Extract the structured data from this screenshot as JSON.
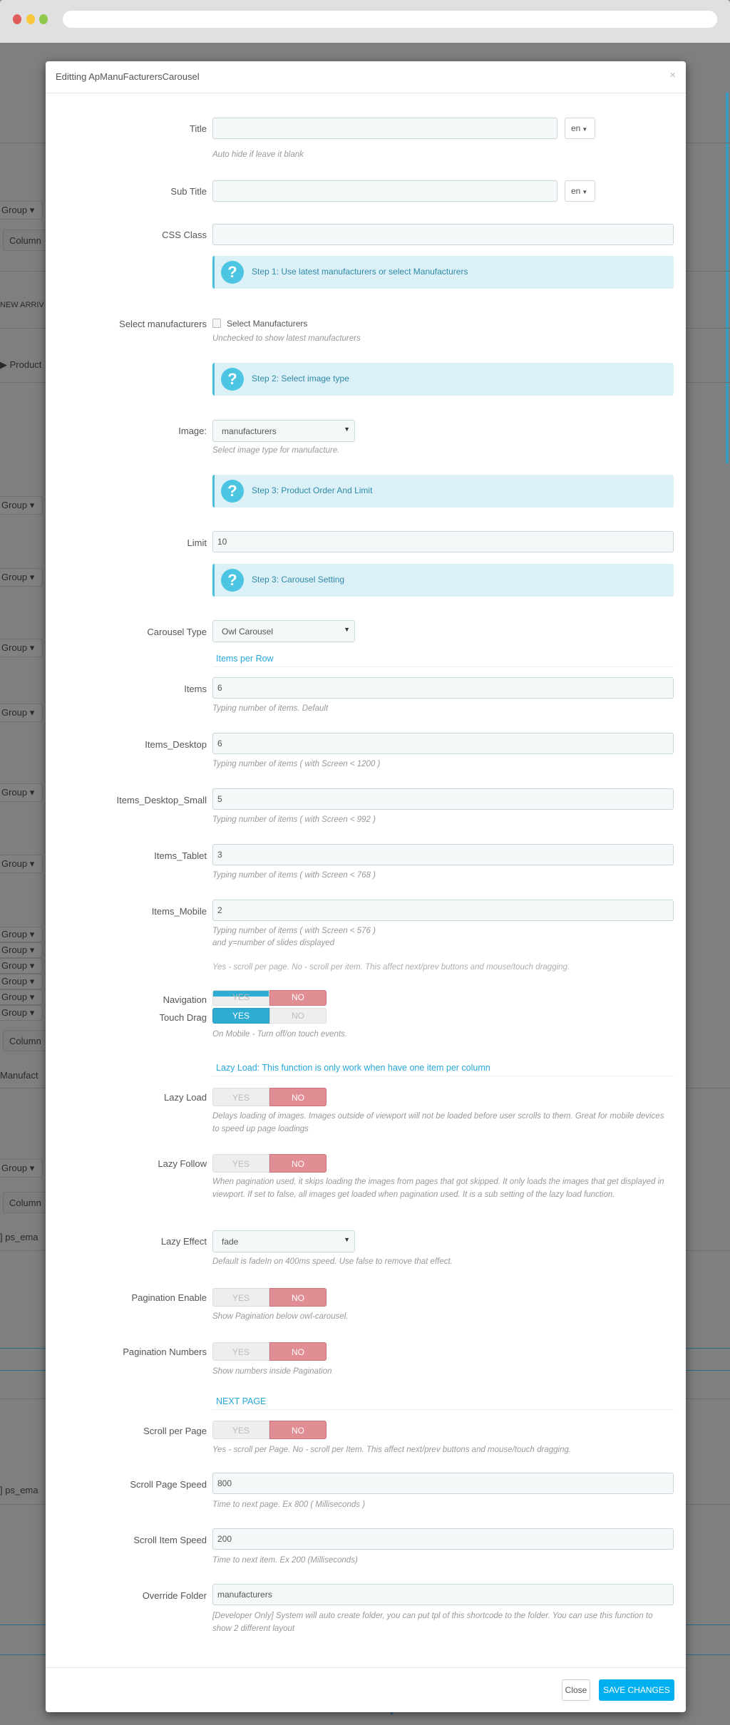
{
  "browser": {},
  "background": {
    "fragments": {
      "group": "Group ▾",
      "column": "Column",
      "new_arrivals": "NEW ARRIV",
      "product": "Product",
      "manufacturers": "Manufact",
      "ps_email": "ps_ema"
    }
  },
  "modal": {
    "title": "Editting ApManuFacturersCarousel",
    "close_icon": "×",
    "fields": {
      "title": {
        "label": "Title",
        "value": "",
        "lang": "en",
        "help": "Auto hide if leave it blank"
      },
      "sub_title": {
        "label": "Sub Title",
        "value": "",
        "lang": "en"
      },
      "css_class": {
        "label": "CSS Class",
        "value": ""
      },
      "select_manufacturers": {
        "label": "Select manufacturers",
        "checkbox_label": "Select Manufacturers",
        "checked": false,
        "help": "Unchecked to show latest manufacturers"
      },
      "image": {
        "label": "Image:",
        "value": "manufacturers",
        "help": "Select image type for manufacture."
      },
      "limit": {
        "label": "Limit",
        "value": "10"
      },
      "carousel_type": {
        "label": "Carousel Type",
        "value": "Owl Carousel"
      },
      "items": {
        "label": "Items",
        "value": "6",
        "help": "Typing number of items. Default"
      },
      "items_desktop": {
        "label": "Items_Desktop",
        "value": "6",
        "help": "Typing number of items ( with Screen < 1200 )"
      },
      "items_desktop_small": {
        "label": "Items_Desktop_Small",
        "value": "5",
        "help": "Typing number of items ( with Screen < 992 )"
      },
      "items_tablet": {
        "label": "Items_Tablet",
        "value": "3",
        "help": "Typing number of items ( with Screen < 768 )"
      },
      "items_mobile": {
        "label": "Items_Mobile",
        "value": "2",
        "help": "Typing number of items ( with Screen < 576 )",
        "help2": "and y=number of slides displayed",
        "help3": "Yes - scroll per page. No - scroll per item. This affect next/prev buttons and mouse/touch dragging."
      },
      "navigation": {
        "label": "Navigation",
        "yes": "YES",
        "no": "NO",
        "value": "NO"
      },
      "touch_drag": {
        "label": "Touch Drag",
        "yes": "YES",
        "no": "NO",
        "value": "YES",
        "help": "On Mobile - Turn off/on touch events."
      },
      "lazy_load": {
        "label": "Lazy Load",
        "yes": "YES",
        "no": "NO",
        "value": "NO",
        "help": "Delays loading of images. Images outside of viewport will not be loaded before user scrolls to them. Great for mobile devices to speed up page loadings"
      },
      "lazy_follow": {
        "label": "Lazy Follow",
        "yes": "YES",
        "no": "NO",
        "value": "NO",
        "help": "When pagination used, it skips loading the images from pages that got skipped. It only loads the images that get displayed in viewport. If set to false, all images get loaded when pagination used. It is a sub setting of the lazy load function."
      },
      "lazy_effect": {
        "label": "Lazy Effect",
        "value": "fade",
        "help": "Default is fadeIn on 400ms speed. Use false to remove that effect."
      },
      "pagination_enable": {
        "label": "Pagination Enable",
        "yes": "YES",
        "no": "NO",
        "value": "NO",
        "help": "Show Pagination below owl-carousel."
      },
      "pagination_numbers": {
        "label": "Pagination Numbers",
        "yes": "YES",
        "no": "NO",
        "value": "NO",
        "help": "Show numbers inside Pagination"
      },
      "scroll_per_page": {
        "label": "Scroll per Page",
        "yes": "YES",
        "no": "NO",
        "value": "NO",
        "help": "Yes - scroll per Page. No - scroll per Item. This affect next/prev buttons and mouse/touch dragging."
      },
      "scroll_page_speed": {
        "label": "Scroll Page Speed",
        "value": "800",
        "help": "Time to next page. Ex 800 ( Milliseconds )"
      },
      "scroll_item_speed": {
        "label": "Scroll Item Speed",
        "value": "200",
        "help": "Time to next item. Ex 200 (Milliseconds)"
      },
      "override_folder": {
        "label": "Override Folder",
        "value": "manufacturers",
        "help": "[Developer Only] System will auto create folder, you can put tpl of this shortcode to the folder. You can use this function to show 2 different layout"
      }
    },
    "alerts": {
      "step1": "Step 1: Use latest manufacturers or select Manufacturers",
      "step2": "Step 2: Select image type",
      "step3a": "Step 3: Product Order And Limit",
      "step3b": "Step 3: Carousel Setting"
    },
    "sections": {
      "items_per_row": "Items per Row",
      "lazy_load": "Lazy Load: This function is only work when have one item per column",
      "next_page": "NEXT PAGE"
    },
    "footer": {
      "close_label": "Close",
      "save_label": "SAVE CHANGES"
    },
    "colors": {
      "accent": "#00aff0",
      "no_active": "#e08d94",
      "yes_active": "#2eacd1",
      "alert_bg": "#dcf1f7"
    }
  }
}
